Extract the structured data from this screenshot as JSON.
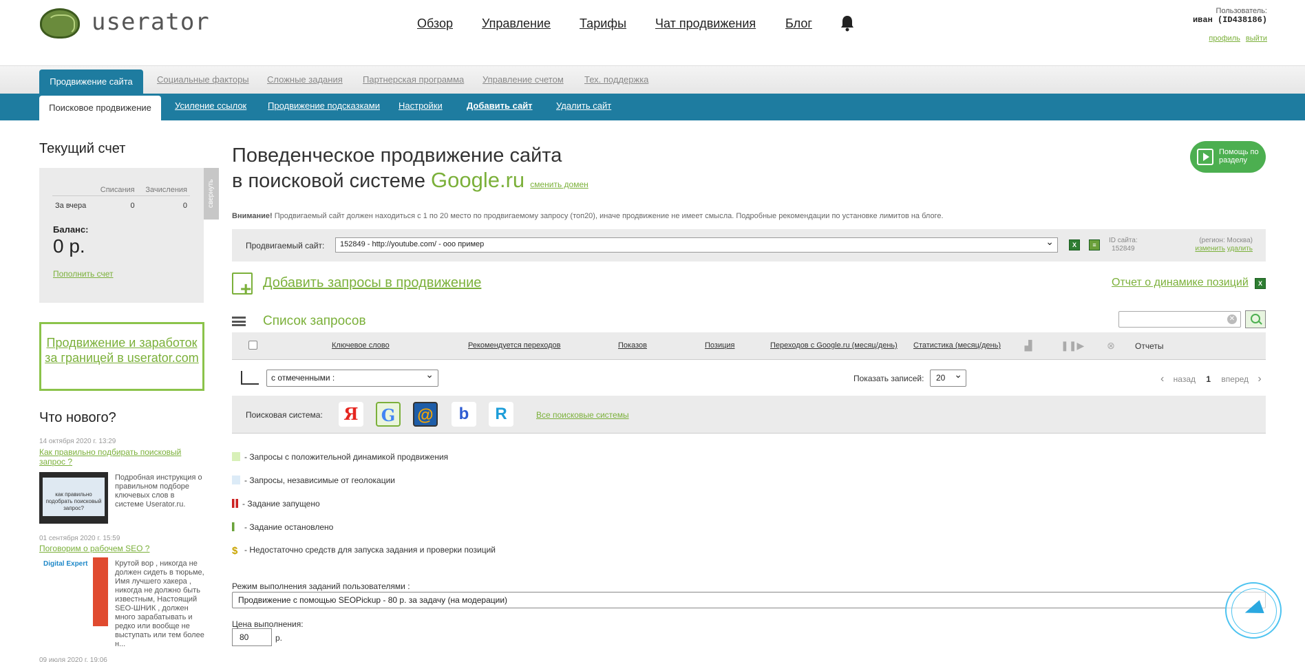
{
  "header": {
    "logo_text": "userator",
    "nav": [
      "Обзор",
      "Управление",
      "Тарифы",
      "Чат продвижения",
      "Блог"
    ],
    "user_label": "Пользователь:",
    "user_name": "иван (ID438186)",
    "profile_link": "профиль",
    "logout_link": "выйти"
  },
  "top_tabs": {
    "active": "Продвижение сайта",
    "items": [
      "Социальные факторы",
      "Сложные задания",
      "Партнерская программа",
      "Управление счетом",
      "Тех. поддержка"
    ]
  },
  "sub_tabs": {
    "active": "Поисковое продвижение",
    "items": [
      "Усиление ссылок",
      "Продвижение подсказками",
      "Настройки",
      "Добавить сайт",
      "Удалить сайт"
    ]
  },
  "sidebar": {
    "account_title": "Текущий счет",
    "collapse_label": "свернуть",
    "col_debits": "Списания",
    "col_credits": "Зачисления",
    "row_label": "За вчера",
    "row_debits": "0",
    "row_credits": "0",
    "balance_label": "Баланс:",
    "balance_value": "0 р.",
    "topup_link": "Пополнить счет",
    "promo_text": "Продвижение и заработок за границей в userator.com",
    "news_title": "Что нового?",
    "news": [
      {
        "date": "14 октября 2020 г. 13:29",
        "title": "Как правильно подбирать поисковый запрос ?",
        "text": "Подробная инструкция о правильном подборе ключевых слов в системе Userator.ru.",
        "thumb_text": "как правильно подобрать поисковый запрос?"
      },
      {
        "date": "01 сентября 2020 г. 15:59",
        "title": "Поговорим о рабочем SEO ?",
        "text": "Крутой вор , никогда не должен сидеть в тюрьме, Имя лучшего хакера , никогда не должно быть известным, Настоящий SEO-ШНИК , должен много зарабатывать и редко или вообще не выступать или тем более н...",
        "thumb_text": "Digital Expert"
      },
      {
        "date": "09 июля 2020 г. 19:06"
      }
    ]
  },
  "main": {
    "title_line1": "Поведенческое продвижение сайта",
    "title_line2": "в поисковой системе",
    "title_engine": "Google.ru",
    "change_domain": "сменить домен",
    "help_button": "Помощь по разделу",
    "warning_bold": "Внимание!",
    "warning_text": "Продвигаемый сайт должен находиться с 1 по 20 место по продвигаемому запросу (топ20), иначе продвижение не имеет смысла. Подробные рекомендации по установке лимитов на блоге.",
    "site_label": "Продвигаемый сайт:",
    "site_value": "152849 - http://youtube.com/ - ооо пример",
    "site_id_label": "ID сайта:",
    "site_id": "152849",
    "region": "(регион: Москва)",
    "region_change": "изменить",
    "region_delete": "удалить",
    "add_queries": "Добавить запросы в продвижение",
    "report_link": "Отчет о динамике позиций",
    "list_title": "Список запросов",
    "search_placeholder": "",
    "columns": [
      "Ключевое слово",
      "Рекомендуется переходов",
      "Показов",
      "Позиция",
      "Переходов с Google.ru (месяц/день)",
      "Статистика (месяц/день)"
    ],
    "reports_col": "Отчеты",
    "bulk_select": "с отмеченными :",
    "show_label": "Показать записей:",
    "show_value": "20",
    "pager_prev": "назад",
    "pager_page": "1",
    "pager_next": "вперед",
    "engines_label": "Поисковая система:",
    "engines": [
      "Яндекс",
      "Google",
      "Mail.ru",
      "Bing",
      "Rambler"
    ],
    "all_engines": "Все поисковые системы",
    "legend": [
      {
        "text": "- Запросы с положительной динамикой продвижения",
        "color": "#d8f0b8"
      },
      {
        "text": "- Запросы, независимые от геолокации",
        "color": "#dcebf7"
      },
      {
        "text": "- Задание запущено",
        "color": "#cc2222"
      },
      {
        "text": "- Задание остановлено",
        "color": "#6aa33a"
      },
      {
        "text": "- Недостаточно средств для запуска задания и проверки позиций",
        "color": "#c9a400"
      }
    ],
    "mode_label": "Режим выполнения заданий пользователями :",
    "mode_value": "Продвижение с помощью SEOPickup - 80 р. за задачу (на модерации)",
    "price_label": "Цена выполнения:",
    "price_value": "80",
    "price_unit": "р."
  },
  "colors": {
    "accent_green": "#7bb03a",
    "bar_blue": "#1e7ca0",
    "help_green": "#4caf50"
  }
}
